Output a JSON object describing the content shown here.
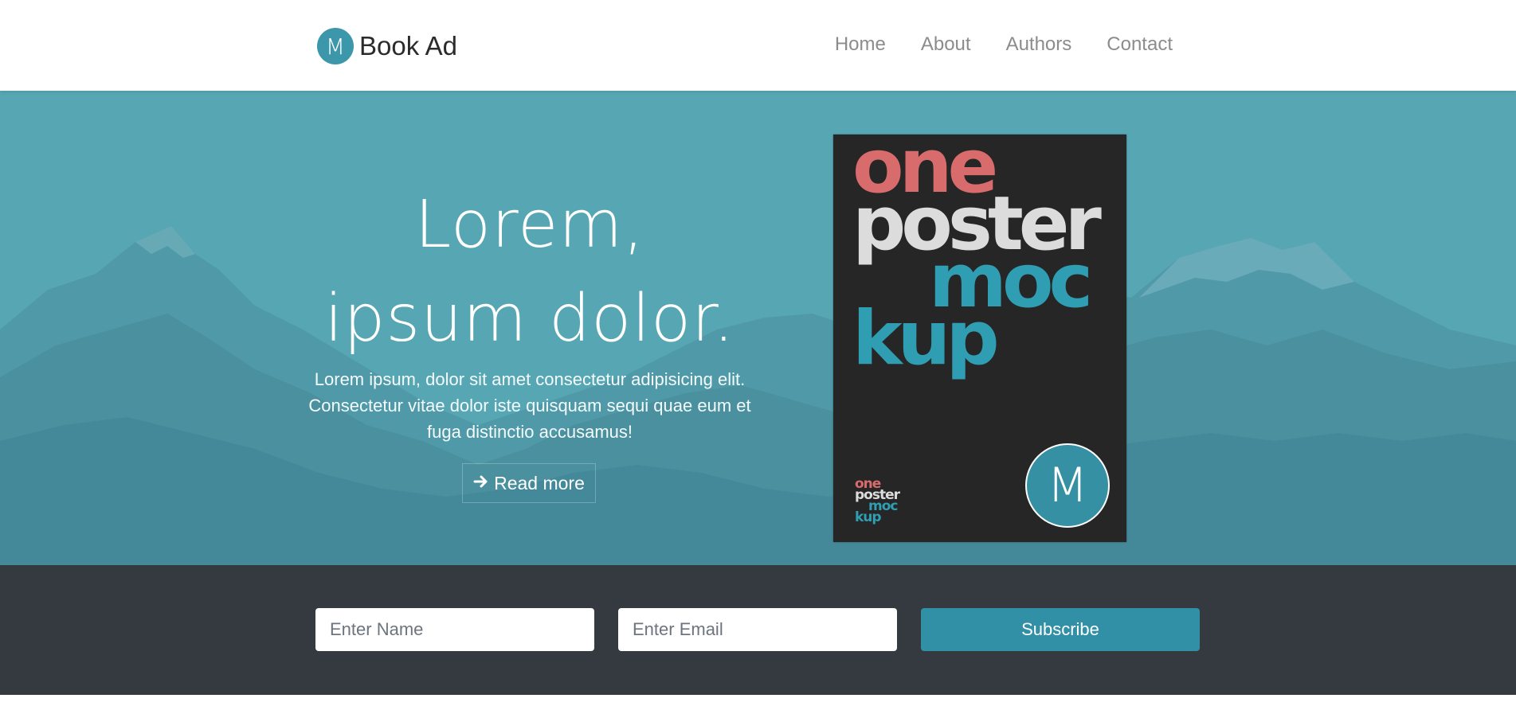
{
  "brand": {
    "logo_letter": "M",
    "name": "Book Ad",
    "logo_color": "#3d97aa"
  },
  "nav": {
    "items": [
      {
        "label": "Home"
      },
      {
        "label": "About"
      },
      {
        "label": "Authors"
      },
      {
        "label": "Contact"
      }
    ]
  },
  "hero": {
    "title_line1": "Lorem,",
    "title_line2": "ipsum dolor.",
    "description": "Lorem ipsum, dolor sit amet consectetur adipisicing elit. Consectetur vitae dolor iste quisquam sequi quae eum et fuga distinctio accusamus!",
    "read_more_label": "Read more",
    "background_color": "#57a6b4"
  },
  "poster": {
    "word1": "one",
    "word2": "poster",
    "word3": "moc",
    "word4": "kup",
    "badge_letter": "M",
    "colors": {
      "one": "#d86b6c",
      "poster": "#dcdcdc",
      "mockup": "#2f9db2",
      "background": "#262626"
    }
  },
  "subscribe": {
    "name_placeholder": "Enter Name",
    "email_placeholder": "Enter Email",
    "button_label": "Subscribe",
    "background_color": "#343a40",
    "button_color": "#3190a6"
  }
}
